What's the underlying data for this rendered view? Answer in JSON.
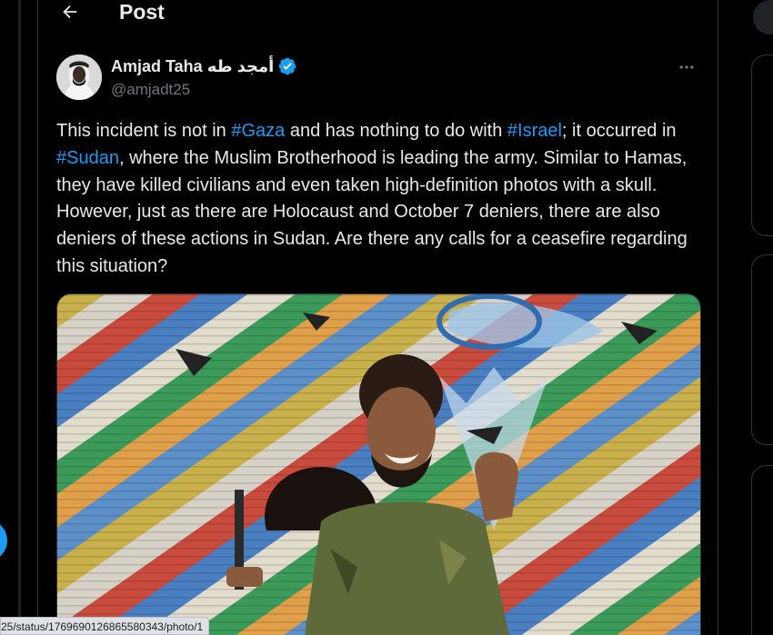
{
  "header": {
    "title": "Post"
  },
  "tweet": {
    "display_name": "Amjad Taha أمجد طه",
    "handle": "@amjadt25",
    "text_parts": {
      "p1": "This incident is not in ",
      "tag1": "#Gaza",
      "p2": " and has nothing to do with ",
      "tag2": "#Israel",
      "p3": "; it occurred in ",
      "tag3": "#Sudan",
      "p4": ", where the Muslim Brotherhood is leading the army. Similar to Hamas, they have killed civilians and even taken high-definition photos with a skull. However, just as there are Holocaust and October 7 deniers, there are also deniers of these actions in Sudan. Are there any calls for a ceasefire regarding this situation?"
    }
  },
  "status_bar": {
    "url": "25/status/1769690126865580343/photo/1"
  },
  "colors": {
    "accent": "#1d9bf0",
    "text": "#e7e9ea",
    "muted": "#71767b",
    "border": "#2f3336"
  },
  "icons": [
    "back-arrow-icon",
    "verified-badge-icon",
    "more-icon"
  ]
}
